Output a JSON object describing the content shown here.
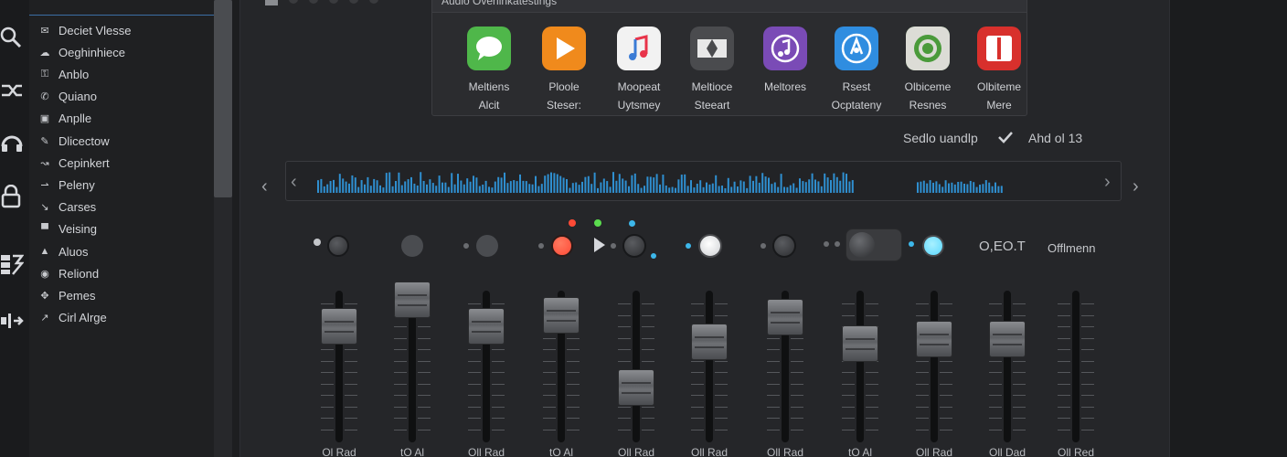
{
  "sidebar": {
    "items": [
      {
        "icon": "envelope-icon",
        "glyph": "✉",
        "label": "Deciet Vlesse"
      },
      {
        "icon": "cloud-icon",
        "glyph": "☁",
        "label": "Oeghinhiece"
      },
      {
        "icon": "lock-icon",
        "glyph": "⚿",
        "label": "Anblo"
      },
      {
        "icon": "phone-icon",
        "glyph": "✆",
        "label": "Quiano"
      },
      {
        "icon": "square-icon",
        "glyph": "▣",
        "label": "Anplle"
      },
      {
        "icon": "pencil-icon",
        "glyph": "✎",
        "label": "Dlicectow"
      },
      {
        "icon": "arrow-icon",
        "glyph": "↝",
        "label": "Cepinkert"
      },
      {
        "icon": "dash-arrow-icon",
        "glyph": "⇀",
        "label": "Peleny"
      },
      {
        "icon": "check-icon",
        "glyph": "↘",
        "label": "Carses"
      },
      {
        "icon": "monitor-icon",
        "glyph": "▀",
        "label": "Veising"
      },
      {
        "icon": "triangle-icon",
        "glyph": "▲",
        "label": "Aluos"
      },
      {
        "icon": "target-icon",
        "glyph": "◉",
        "label": "Reliond"
      },
      {
        "icon": "move-icon",
        "glyph": "✥",
        "label": "Pemes"
      },
      {
        "icon": "link-icon",
        "glyph": "↗",
        "label": "Cirl Alrge"
      }
    ]
  },
  "popup": {
    "title": "Audio Overlinkatestings",
    "apps": [
      {
        "icon": "messages-icon",
        "color": "#4fb74a",
        "line1": "Meltiens",
        "line2": "Alcit"
      },
      {
        "icon": "play-icon",
        "color": "#f08a1c",
        "line1": "Ploole",
        "line2": "Steser:"
      },
      {
        "icon": "music-note-icon",
        "color": "#f2f2f2",
        "line1": "Moopeat",
        "line2": "Uytsmey"
      },
      {
        "icon": "film-icon",
        "color": "#4a4b4e",
        "line1": "Meltioce",
        "line2": "Steeart"
      },
      {
        "icon": "podcast-icon",
        "color": "#7a4bb6",
        "line1": "Meltores",
        "line2": ""
      },
      {
        "icon": "shazam-icon",
        "color": "#2f8de0",
        "line1": "Rsest",
        "line2": "Ocptateny"
      },
      {
        "icon": "target-app-icon",
        "color": "#4a9a3a",
        "line1": "Olbiceme",
        "line2": "Resnes"
      },
      {
        "icon": "red-app-icon",
        "color": "#d8302c",
        "line1": "Olbiteme",
        "line2": "Mere"
      }
    ]
  },
  "status": {
    "label": "Sedlo uandlp",
    "count": "Ahd ol 13"
  },
  "controls": {
    "text1": "O,EO.T",
    "text2": "Offlmenn"
  },
  "faders": {
    "levels": [
      0.76,
      1.0,
      0.76,
      0.86,
      0.2,
      0.62,
      0.84,
      0.6,
      0.64,
      0.64,
      0.0
    ],
    "labels": [
      "Ol Rad",
      "tO Al",
      "Oll Rad",
      "tO Al",
      "Oll Rad",
      "Oll Rad",
      "Oll Rad",
      "tO Al",
      "Oll Rad",
      "Oll Dad",
      "Oll Red"
    ]
  },
  "colors": {
    "waveform": "#2f8fd0",
    "accent_red": "#ff4a36",
    "accent_green": "#5bdc4e",
    "accent_blue": "#3db7ea",
    "accent_cyan": "#59d7ff"
  }
}
